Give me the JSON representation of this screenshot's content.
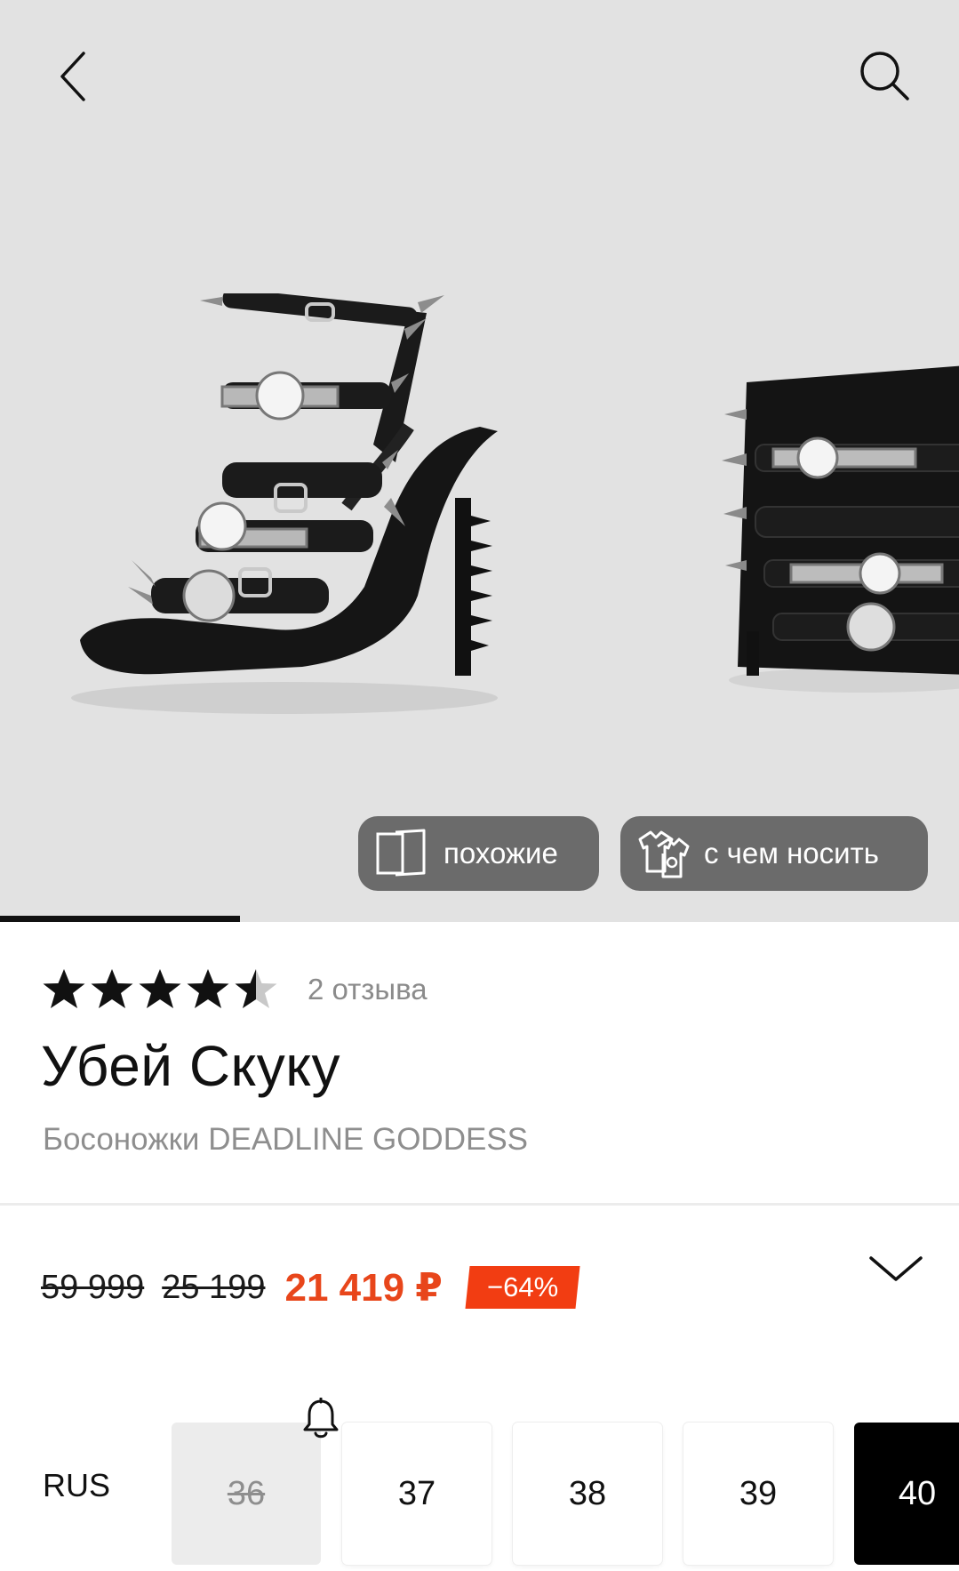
{
  "header": {
    "back_icon": "chevron-left-icon",
    "search_icon": "search-icon"
  },
  "gallery": {
    "image_count_shown": 2,
    "progress": 0.25,
    "chips": {
      "similar_label": "похожие",
      "similar_icon": "cards-stack-icon",
      "outfit_label": "с чем носить",
      "outfit_icon": "tshirts-icon"
    }
  },
  "product": {
    "rating": 4.5,
    "rating_max": 5,
    "reviews_label": "2 отзыва",
    "brand": "Убей Скуку",
    "title": "Босоножки DEADLINE GODDESS"
  },
  "price": {
    "original": "59 999",
    "previous": "25 199",
    "current": "21 419 ₽",
    "discount": "−64%",
    "accent_color": "#e8461b",
    "badge_color": "#f23d12"
  },
  "sizes": {
    "system": "RUS",
    "items": [
      {
        "label": "36",
        "state": "unavailable",
        "subscribe_icon": "bell-icon"
      },
      {
        "label": "37",
        "state": "available"
      },
      {
        "label": "38",
        "state": "available"
      },
      {
        "label": "39",
        "state": "available"
      },
      {
        "label": "40",
        "state": "selected"
      }
    ]
  }
}
